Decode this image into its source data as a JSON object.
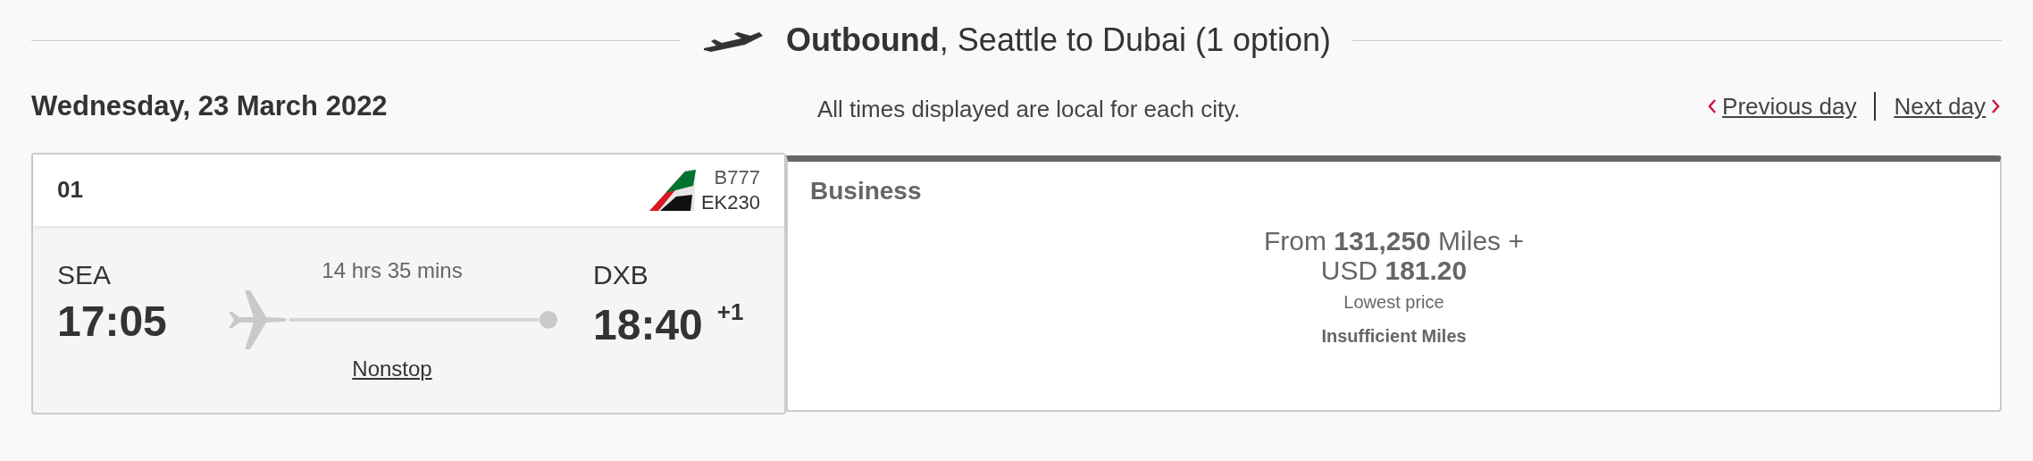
{
  "heading": "**Outbound**, Seattle to Dubai (1 option)",
  "date": "Wednesday, 23 March 2022",
  "note": "All times displayed are local for each city.",
  "day_nav": [
    {
      "label": "Previous day",
      "kind": "prev"
    },
    {
      "label": "Next day",
      "kind": "next"
    }
  ],
  "flight": {
    "number": "01",
    "aircraft": "B777",
    "flight_code": "EK230",
    "origin": {
      "code": "SEA",
      "time": "17:05"
    },
    "duration": "14 hrs 35 mins",
    "stops": "Nonstop",
    "destination": {
      "code": "DXB",
      "time": "18:40",
      "day_offset": "+1"
    }
  },
  "fare": {
    "cabin": "Business",
    "price_lines": [
      "From **131,250** Miles +",
      "USD **181.20**"
    ],
    "price_note": "Lowest price",
    "status": "Insufficient Miles"
  }
}
